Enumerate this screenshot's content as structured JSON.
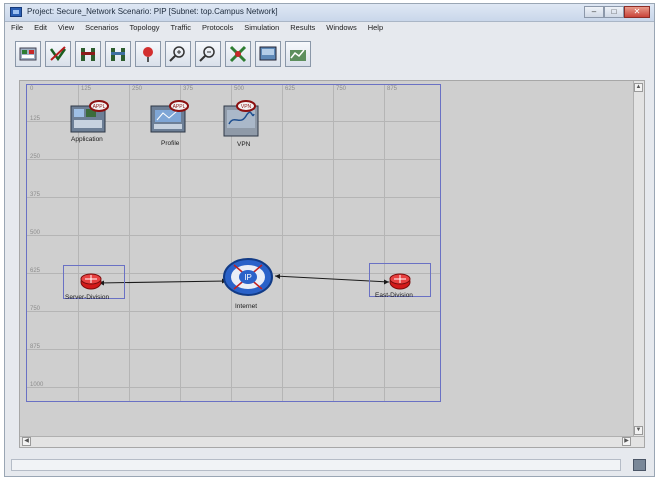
{
  "window": {
    "title": "Project: Secure_Network Scenario: PIP  [Subnet: top.Campus Network]"
  },
  "menu": [
    "File",
    "Edit",
    "View",
    "Scenarios",
    "Topology",
    "Traffic",
    "Protocols",
    "Simulation",
    "Results",
    "Windows",
    "Help"
  ],
  "toolbar": {
    "buttons": [
      {
        "name": "open-palette-icon"
      },
      {
        "name": "check-links-icon"
      },
      {
        "name": "fail-node-icon"
      },
      {
        "name": "recover-node-icon"
      },
      {
        "name": "return-parent-icon"
      },
      {
        "name": "zoom-in-icon"
      },
      {
        "name": "zoom-out-icon"
      },
      {
        "name": "configure-discrete-event-icon"
      },
      {
        "name": "view-results-icon"
      },
      {
        "name": "hide-graphs-icon"
      }
    ]
  },
  "grid": {
    "x_ticks": [
      "0",
      "125",
      "250",
      "375",
      "500",
      "625",
      "750",
      "875"
    ],
    "y_ticks": [
      "125",
      "250",
      "375",
      "500",
      "625",
      "750",
      "875",
      "1000"
    ]
  },
  "nodes": {
    "application": {
      "label": "Application",
      "badge": "APPL"
    },
    "profile": {
      "label": "Profile",
      "badge": "APPL"
    },
    "vpn": {
      "label": "VPN",
      "badge": "VPN"
    },
    "server_division": {
      "label": "Server-Division"
    },
    "internet": {
      "label": "Internet",
      "badge": "IP"
    },
    "east_division": {
      "label": "East-Division"
    }
  },
  "colors": {
    "selection": "#6a71c4",
    "router": "#d21a1a",
    "internet": "#2a62c9",
    "badge_ring": "#8b1010"
  }
}
